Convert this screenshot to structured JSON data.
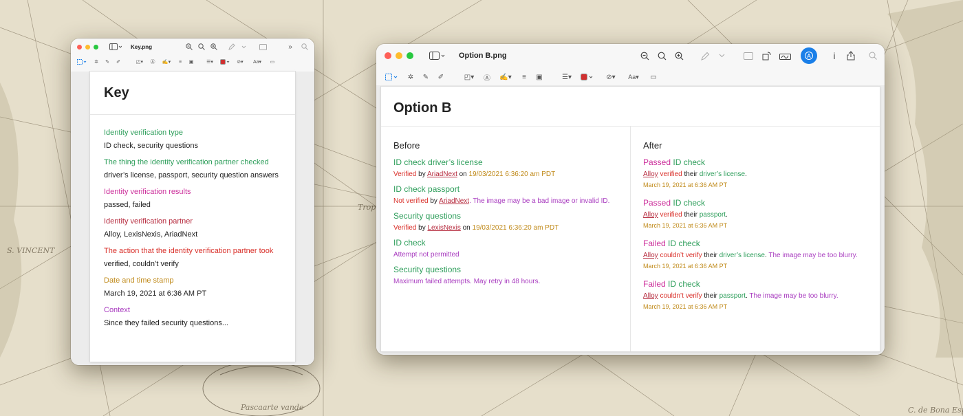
{
  "key_window": {
    "title": "Key.png",
    "heading": "Key",
    "entries": [
      {
        "label": "Identity verification type",
        "value": "ID check, security questions",
        "color": "#2e9e5b"
      },
      {
        "label": "The thing the identity verification partner checked",
        "value": "driver’s license, passport, security question answers",
        "color": "#2e9e5b"
      },
      {
        "label": "Identity verification results",
        "value": "passed, failed",
        "color": "#cc2f9b"
      },
      {
        "label": "Identity verification partner",
        "value": "Alloy, LexisNexis, AriadNext",
        "color": "#b62b3e"
      },
      {
        "label": "The action that the identity verification partner took",
        "value": "verified, couldn’t verify",
        "color": "#d9302a"
      },
      {
        "label": "Date and time stamp",
        "value": "March 19, 2021 at 6:36 AM PT",
        "color": "#c08a1a"
      },
      {
        "label": "Context",
        "value": "Since they failed security questions...",
        "color": "#a83bbf"
      }
    ]
  },
  "option_window": {
    "title": "Option B.png",
    "heading": "Option B",
    "before": {
      "heading": "Before",
      "items": [
        {
          "check": "ID check",
          "subject": "driver’s license",
          "status": "Verified",
          "by": "by",
          "partner": "AriadNext",
          "on": "on",
          "timestamp": "19/03/2021 6:36:20 am PDT",
          "context": ""
        },
        {
          "check": "ID check",
          "subject": "passport",
          "status": "Not verified",
          "by": "by",
          "partner": "AriadNext",
          "on": "",
          "timestamp": "",
          "context": ". The image may be a bad image or invalid ID."
        },
        {
          "check": "Security questions",
          "subject": "",
          "status": "Verified",
          "by": "by",
          "partner": "LexisNexis",
          "on": "on",
          "timestamp": "19/03/2021 6:36:20 am PDT",
          "context": ""
        },
        {
          "check": "ID check",
          "subject": "",
          "status": "",
          "by": "",
          "partner": "",
          "on": "",
          "timestamp": "",
          "context": "Attempt not permitted"
        },
        {
          "check": "Security questions",
          "subject": "",
          "status": "",
          "by": "",
          "partner": "",
          "on": "",
          "timestamp": "",
          "context": "Maximum failed attempts. May retry in 48 hours."
        }
      ]
    },
    "after": {
      "heading": "After",
      "items": [
        {
          "result": "Passed",
          "check": "ID check",
          "partner": "Alloy",
          "action": "verified",
          "their": "their",
          "subject": "driver’s license",
          "dot": ".",
          "context": "",
          "timestamp": "March 19, 2021 at 6:36 AM PT"
        },
        {
          "result": "Passed",
          "check": "ID check",
          "partner": "Alloy",
          "action": "verified",
          "their": "their",
          "subject": "passport",
          "dot": ".",
          "context": "",
          "timestamp": "March 19, 2021 at 6:36 AM PT"
        },
        {
          "result": "Failed",
          "check": "ID check",
          "partner": "Alloy",
          "action": "couldn’t verify",
          "their": "their",
          "subject": "driver’s license",
          "dot": ".",
          "context": " The image may be too blurry.",
          "timestamp": "March 19, 2021 at 6:36 AM PT"
        },
        {
          "result": "Failed",
          "check": "ID check",
          "partner": "Alloy",
          "action": "couldn’t verify",
          "their": "their",
          "subject": "passport",
          "dot": ".",
          "context": " The image may be too blurry.",
          "timestamp": "March 19, 2021 at 6:36 AM PT"
        }
      ]
    }
  },
  "toolbar_icons": [
    "sidebar-icon",
    "zoom-out-icon",
    "zoom-fit-icon",
    "zoom-in-icon",
    "markup-pen-icon",
    "chevron-down-icon",
    "crop-icon",
    "rotate-icon",
    "signature-icon",
    "account-icon",
    "info-icon",
    "share-icon",
    "search-icon"
  ],
  "colors": {
    "accent": "#1a7fe8",
    "green": "#2e9e5b",
    "magenta": "#cc2f9b",
    "red": "#d9302a",
    "gold": "#c08a1a",
    "purple": "#a83bbf",
    "partner": "#b62b3e"
  }
}
